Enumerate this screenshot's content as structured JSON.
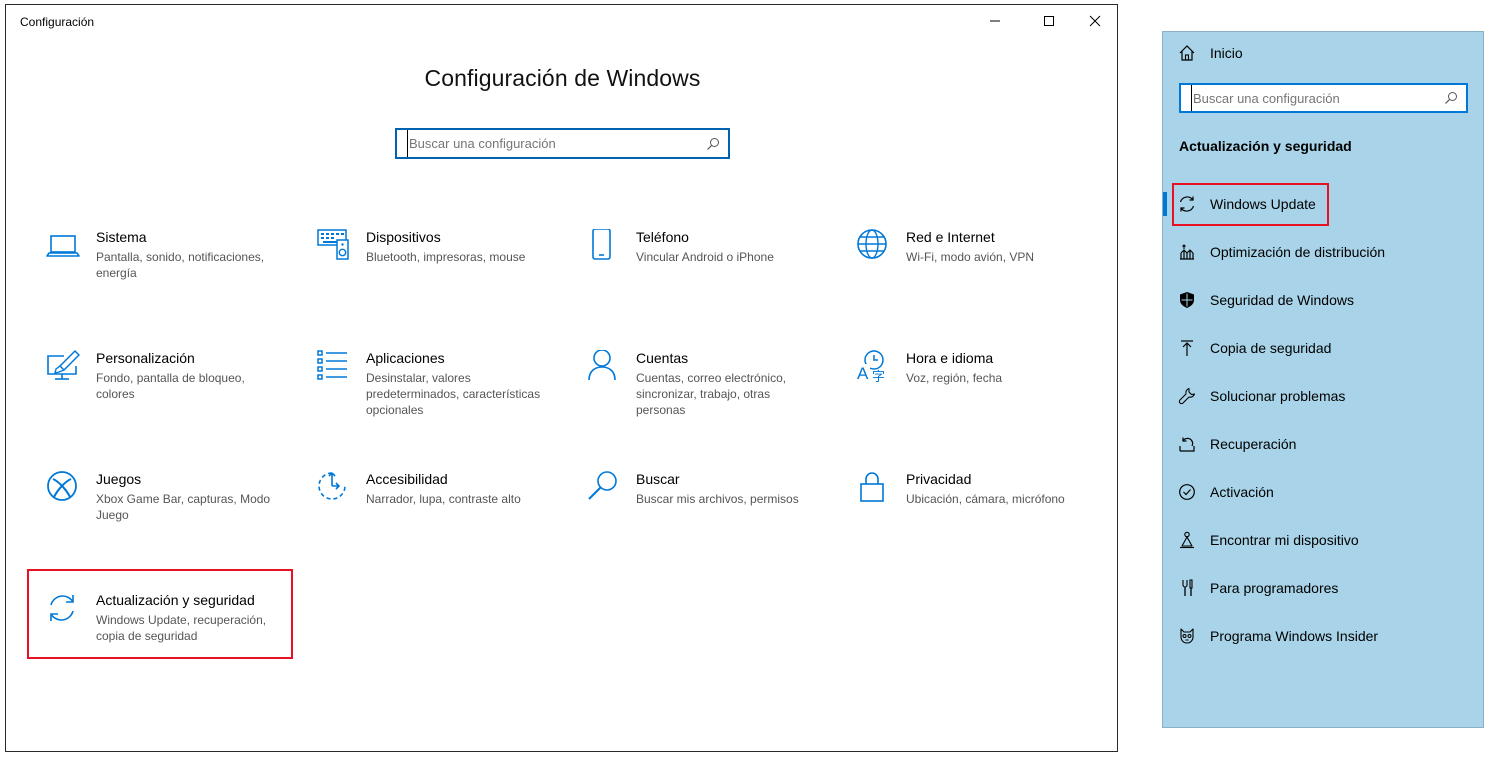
{
  "window": {
    "app_title": "Configuración",
    "main_title": "Configuración de Windows",
    "search_placeholder": "Buscar una configuración"
  },
  "categories": [
    {
      "icon": "laptop-icon",
      "title": "Sistema",
      "desc": "Pantalla, sonido, notificaciones, energía"
    },
    {
      "icon": "keyboard-speaker-icon",
      "title": "Dispositivos",
      "desc": "Bluetooth, impresoras, mouse"
    },
    {
      "icon": "phone-icon",
      "title": "Teléfono",
      "desc": "Vincular Android o iPhone"
    },
    {
      "icon": "globe-icon",
      "title": "Red e Internet",
      "desc": "Wi-Fi, modo avión, VPN"
    },
    {
      "icon": "paint-monitor-icon",
      "title": "Personalización",
      "desc": "Fondo, pantalla de bloqueo, colores"
    },
    {
      "icon": "app-list-icon",
      "title": "Aplicaciones",
      "desc": "Desinstalar, valores predeterminados, características opcionales"
    },
    {
      "icon": "person-icon",
      "title": "Cuentas",
      "desc": "Cuentas, correo electrónico, sincronizar, trabajo, otras personas"
    },
    {
      "icon": "time-language-icon",
      "title": "Hora e idioma",
      "desc": "Voz, región, fecha"
    },
    {
      "icon": "xbox-icon",
      "title": "Juegos",
      "desc": "Xbox Game Bar, capturas, Modo Juego"
    },
    {
      "icon": "accessibility-icon",
      "title": "Accesibilidad",
      "desc": "Narrador, lupa, contraste alto"
    },
    {
      "icon": "magnifier-icon",
      "title": "Buscar",
      "desc": "Buscar mis archivos, permisos"
    },
    {
      "icon": "lock-icon",
      "title": "Privacidad",
      "desc": "Ubicación, cámara, micrófono"
    },
    {
      "icon": "sync-arrows-icon",
      "title": "Actualización y seguridad",
      "desc": "Windows Update, recuperación, copia de seguridad"
    }
  ],
  "side_panel": {
    "home_label": "Inicio",
    "search_placeholder": "Buscar una configuración",
    "heading": "Actualización y seguridad",
    "items": [
      {
        "icon": "sync-icon",
        "label": "Windows Update",
        "selected": true
      },
      {
        "icon": "delivery-optimization-icon",
        "label": "Optimización de distribución"
      },
      {
        "icon": "shield-icon",
        "label": "Seguridad de Windows"
      },
      {
        "icon": "backup-arrow-icon",
        "label": "Copia de seguridad"
      },
      {
        "icon": "wrench-icon",
        "label": "Solucionar problemas"
      },
      {
        "icon": "recovery-icon",
        "label": "Recuperación"
      },
      {
        "icon": "check-circle-icon",
        "label": "Activación"
      },
      {
        "icon": "find-device-icon",
        "label": "Encontrar mi dispositivo"
      },
      {
        "icon": "developer-tools-icon",
        "label": "Para programadores"
      },
      {
        "icon": "insider-cat-icon",
        "label": "Programa Windows Insider"
      }
    ]
  },
  "colors": {
    "accent": "#0078d7",
    "highlight": "#e81123",
    "side_panel_bg": "#a8d3e8"
  }
}
